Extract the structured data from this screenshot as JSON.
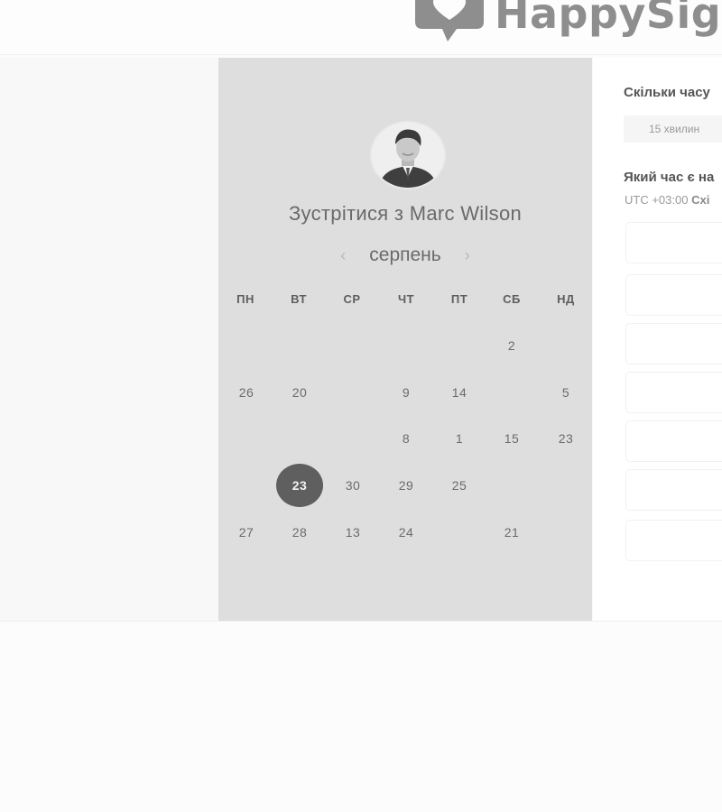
{
  "brand": {
    "name": "HappySigna"
  },
  "booking": {
    "title": "Зустрітися з Marc Wilson",
    "month": "серпень",
    "prev_icon": "‹",
    "next_icon": "›"
  },
  "calendar": {
    "weekdays": [
      "ПН",
      "ВТ",
      "СР",
      "ЧТ",
      "ПТ",
      "СБ",
      "НД"
    ],
    "rows": [
      [
        {
          "label": "",
          "state": "muted"
        },
        {
          "label": "",
          "state": "muted"
        },
        {
          "label": "",
          "state": "muted"
        },
        {
          "label": "",
          "state": "muted"
        },
        {
          "label": "",
          "state": "muted"
        },
        {
          "label": "2",
          "state": "available"
        },
        {
          "label": "",
          "state": "muted"
        }
      ],
      [
        {
          "label": "26",
          "state": "available"
        },
        {
          "label": "20",
          "state": "available"
        },
        {
          "label": "",
          "state": "muted"
        },
        {
          "label": "9",
          "state": "available"
        },
        {
          "label": "14",
          "state": "available"
        },
        {
          "label": "",
          "state": "muted"
        },
        {
          "label": "5",
          "state": "available"
        }
      ],
      [
        {
          "label": "",
          "state": "muted"
        },
        {
          "label": "",
          "state": "muted"
        },
        {
          "label": "",
          "state": "muted"
        },
        {
          "label": "8",
          "state": "available"
        },
        {
          "label": "1",
          "state": "available"
        },
        {
          "label": "15",
          "state": "available"
        },
        {
          "label": "23",
          "state": "available"
        }
      ],
      [
        {
          "label": "",
          "state": "muted"
        },
        {
          "label": "23",
          "state": "selected"
        },
        {
          "label": "30",
          "state": "available"
        },
        {
          "label": "29",
          "state": "available"
        },
        {
          "label": "25",
          "state": "available"
        },
        {
          "label": "",
          "state": "muted"
        },
        {
          "label": "",
          "state": "muted"
        }
      ],
      [
        {
          "label": "27",
          "state": "available"
        },
        {
          "label": "28",
          "state": "available"
        },
        {
          "label": "13",
          "state": "available"
        },
        {
          "label": "24",
          "state": "available"
        },
        {
          "label": "",
          "state": "muted"
        },
        {
          "label": "21",
          "state": "available"
        },
        {
          "label": "",
          "state": "muted"
        }
      ]
    ]
  },
  "right_panel": {
    "duration_question": "Скільки часу",
    "duration_option": "15 хвилин",
    "time_question": "Який час є на",
    "timezone_offset": "UTC +03:00",
    "timezone_name": "Схі",
    "time_slots": [
      "",
      "",
      "",
      "",
      "",
      "",
      ""
    ]
  },
  "colors": {
    "panel_bg": "#dedede",
    "selected_day": "#5f5f5f",
    "logo": "#8e8e8e"
  },
  "icons": {
    "logo": "speech-bubble-heart-icon",
    "avatar": "person-photo"
  }
}
